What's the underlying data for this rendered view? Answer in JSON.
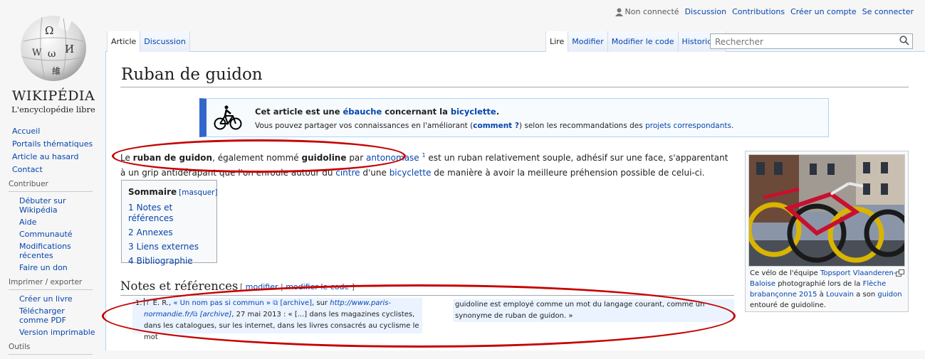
{
  "personal": {
    "anon": "Non connecté",
    "links": [
      "Discussion",
      "Contributions",
      "Créer un compte",
      "Se connecter"
    ]
  },
  "logo": {
    "wordmark": "WIKIPÉDIA",
    "tagline": "L'encyclopédie libre"
  },
  "sidebar": {
    "nav": [
      "Accueil",
      "Portails thématiques",
      "Article au hasard",
      "Contact"
    ],
    "contribute": {
      "heading": "Contribuer",
      "items": [
        "Débuter sur Wikipédia",
        "Aide",
        "Communauté",
        "Modifications récentes",
        "Faire un don"
      ]
    },
    "print": {
      "heading": "Imprimer / exporter",
      "items": [
        "Créer un livre",
        "Télécharger comme PDF",
        "Version imprimable"
      ]
    },
    "tools_heading": "Outils"
  },
  "tabs": {
    "left": [
      "Article",
      "Discussion"
    ],
    "right": [
      "Lire",
      "Modifier",
      "Modifier le code",
      "Historique"
    ]
  },
  "search": {
    "placeholder": "Rechercher"
  },
  "article": {
    "title": "Ruban de guidon",
    "stub": {
      "p1": "Cet article est une ",
      "link1": "ébauche",
      "p2": " concernant la ",
      "link2": "bicyclette",
      "p3": ".",
      "l2a": "Vous pouvez partager vos connaissances en l'améliorant (",
      "l2link": "comment ?",
      "l2b": ") selon les recommandations des ",
      "l2link2": "projets correspondants",
      "l2c": "."
    },
    "intro": {
      "t1": "Le ",
      "b1": "ruban de guidon",
      "t2": ", également nommé ",
      "b2": "guidoline",
      "t3": " par ",
      "link1": "antonomase",
      "sup": "1",
      "t4": " est un ruban relativement souple, adhésif sur une face, s'apparentant à un grip antidérapant que l'on enroule autour du ",
      "link2": "cintre",
      "t5": " d'une ",
      "link3": "bicyclette",
      "t6": " de manière à avoir la meilleure préhension possible de celui-ci."
    },
    "toc": {
      "title": "Sommaire",
      "hide": "[masquer]",
      "items": [
        {
          "num": "1",
          "label": "Notes et références"
        },
        {
          "num": "2",
          "label": "Annexes"
        },
        {
          "num": "3",
          "label": "Liens externes"
        },
        {
          "num": "4",
          "label": "Bibliographie"
        }
      ]
    },
    "notes": {
      "heading": "Notes et références",
      "edit_open": "[ ",
      "edit1": "modifier",
      "edit_sep": " | ",
      "edit2": "modifier le code",
      "edit_close": " ]",
      "ref_num": "1.",
      "ref_arrow": "↑",
      "ref_a1": " E. R., ",
      "ref_a_link": "« Un nom pas si commun »",
      "ref_a_archive": "[archive]",
      "ref_a2": ", sur ",
      "ref_a_url": "http://www.paris-normandie.fr/",
      "ref_a_archive2": "[archive]",
      "ref_a3": ", 27 mai 2013 : « [...] dans les magazines cyclistes, dans les catalogues, sur les internet, dans les livres consacrés au cyclisme le mot",
      "ref_b": "guidoline est employé comme un mot du langage courant, comme un synonyme de ruban de guidon. »"
    },
    "thumb": {
      "c1": "Ce vélo de l'équipe ",
      "link1": "Topsport Vlaanderen-Baloise",
      "c2": " photographié lors de la ",
      "link2": "Flèche brabançonne 2015",
      "c3": " à ",
      "link3": "Louvain",
      "c4": " a son ",
      "link4": "guidon",
      "c5": " entouré de guidoline."
    }
  },
  "colors": {
    "link": "#0645ad",
    "annotation": "#c60000",
    "stub_border": "#3366cc"
  }
}
